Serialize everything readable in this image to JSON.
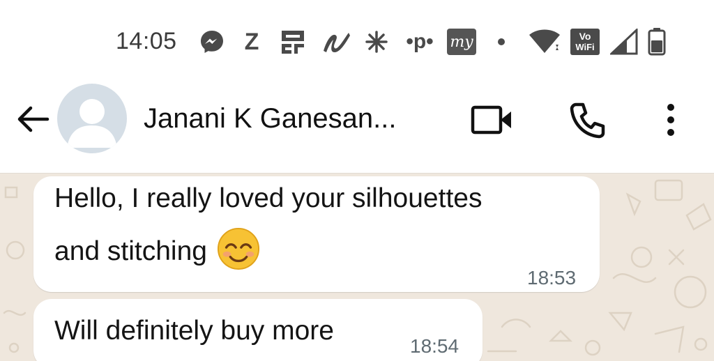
{
  "status_bar": {
    "time": "14:05",
    "icons": [
      "messenger-icon",
      "z-app-icon",
      "qr-app-icon",
      "swirl-app-icon",
      "spark-icon",
      "paytm-icon",
      "my-app-icon",
      "dot-icon",
      "wifi-icon",
      "vowifi-icon",
      "signal-icon",
      "battery-icon"
    ],
    "z_label": "Z",
    "p_label": "•p•",
    "my_label": "my",
    "vowifi_top": "Vo",
    "vowifi_bottom": "WiFi"
  },
  "header": {
    "contact_name": "Janani K Ganesan...",
    "icons": [
      "back-arrow-icon",
      "video-call-icon",
      "phone-icon",
      "more-vert-icon"
    ]
  },
  "messages": [
    {
      "line1": "Hello, I really loved your silhouettes",
      "line2": "and stitching",
      "emoji": "smiling-face-with-smiling-eyes",
      "time": "18:53"
    },
    {
      "line1": "Will definitely buy more",
      "time": "18:54"
    }
  ],
  "colors": {
    "chat_background": "#efe7dd",
    "bubble": "#ffffff",
    "avatar_background": "#d5dee6",
    "emoji_yellow": "#f7c234"
  }
}
